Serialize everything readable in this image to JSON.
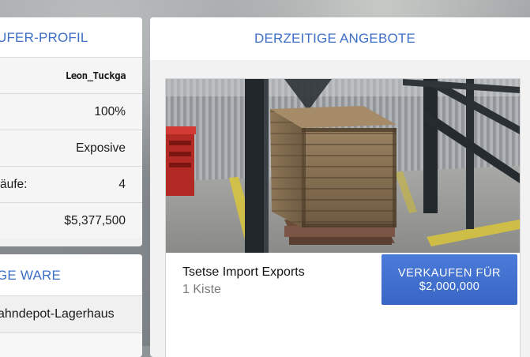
{
  "profile": {
    "title": "UFER-PROFIL",
    "rows": [
      {
        "label": "",
        "value": "Leon_Tuckga"
      },
      {
        "label": "",
        "value": "100%"
      },
      {
        "label": "",
        "value": "Exposive"
      },
      {
        "label": "äufe:",
        "value": "4"
      },
      {
        "label": "",
        "value": "$5,377,500"
      }
    ]
  },
  "ware": {
    "title": "GE WARE",
    "rows": [
      "ahndepot-Lagerhaus",
      ""
    ]
  },
  "offers": {
    "title": "DERZEITIGE ANGEBOTE",
    "card": {
      "name": "Tsetse Import Exports",
      "quantity": "1 Kiste",
      "sell_line1": "VERKAUFEN FÜR",
      "sell_line2": "$2,000,000"
    }
  },
  "colors": {
    "accent": "#3d6fc8",
    "button": "#4170cf"
  }
}
